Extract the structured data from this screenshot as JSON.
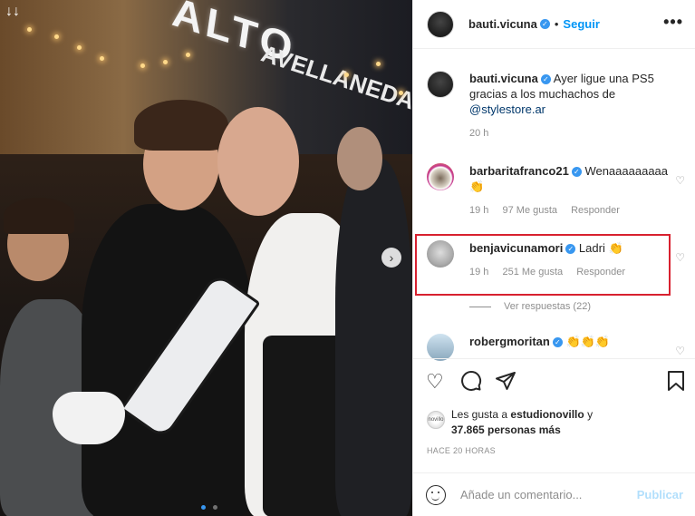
{
  "post": {
    "author": "bauti.vicuna",
    "follow_label": "Seguir",
    "more_label": "•••",
    "separator": "•",
    "verified_mark": "✓",
    "caption": {
      "user": "bauti.vicuna",
      "text_prefix": " Ayer ligue una PS5 gracias a los muchachos de ",
      "mention": "@stylestore.ar",
      "time": "20 h"
    }
  },
  "photo": {
    "sign_text": "ALTO",
    "sign_text2": "AVELLANEDA",
    "next_label": "›",
    "download_icons": "↓↓"
  },
  "comments": [
    {
      "user": "barbaritafranco21",
      "text": " Wenaaaaaaaaa 👏",
      "time": "19 h",
      "likes": "97 Me gusta",
      "reply": "Responder"
    },
    {
      "user": "benjavicunamori",
      "text": " Ladri 👏",
      "time": "19 h",
      "likes": "251 Me gusta",
      "reply": "Responder"
    },
    {
      "user": "robergmoritan",
      "text": " 👏👏👏"
    }
  ],
  "view_replies": "Ver respuestas (22)",
  "likes_line": {
    "prefix": "Les gusta a ",
    "user": "estudionovillo",
    "middle": " y",
    "count": "37.865 personas más",
    "avatar_text": "novillo"
  },
  "time_ago": "HACE 20 HORAS",
  "add_comment": {
    "placeholder": "Añade un comentario...",
    "publish": "Publicar"
  },
  "colors": {
    "accent": "#0095f6",
    "verified": "#3897f0",
    "highlight": "#d8212f",
    "muted": "#8e8e8e"
  }
}
